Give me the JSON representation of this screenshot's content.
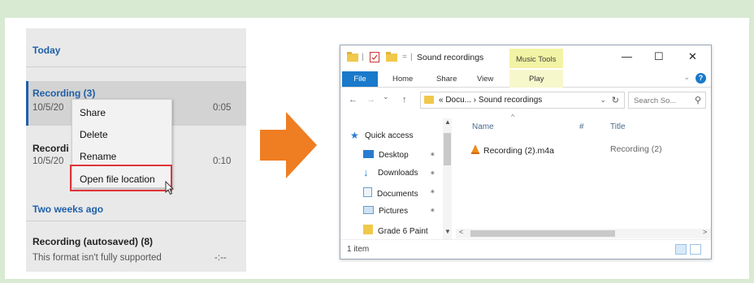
{
  "voice_recorder": {
    "section_today": "Today",
    "recording_selected": {
      "title": "Recording (3)",
      "date": "10/5/20",
      "duration": "0:05"
    },
    "recording_second": {
      "title": "Recordi",
      "date": "10/5/20",
      "duration": "0:10"
    },
    "section_two_weeks": "Two weeks ago",
    "recording_autosaved": {
      "title": "Recording (autosaved) (8)",
      "note": "This format isn't fully supported",
      "duration": "-:--"
    },
    "context_menu": {
      "items": [
        "Share",
        "Delete",
        "Rename",
        "Open file location"
      ]
    }
  },
  "explorer": {
    "title": "Sound recordings",
    "title_separator": "|",
    "qat_caret": "=",
    "context_tab_group": "Music Tools",
    "window_controls": {
      "minimize": "—",
      "maximize": "☐",
      "close": "✕"
    },
    "ribbon": {
      "tabs": [
        "File",
        "Home",
        "Share",
        "View"
      ],
      "context_tab": "Play"
    },
    "nav_buttons": {
      "back": "←",
      "forward": "→",
      "recent": "⌄",
      "up": "↑"
    },
    "address": "« Docu... › Sound recordings",
    "search_placeholder": "Search So...",
    "nav_pane": [
      {
        "label": "Quick access",
        "icon": "star-icon"
      },
      {
        "label": "Desktop",
        "icon": "desktop-icon"
      },
      {
        "label": "Downloads",
        "icon": "download-icon"
      },
      {
        "label": "Documents",
        "icon": "documents-icon"
      },
      {
        "label": "Pictures",
        "icon": "pictures-icon"
      },
      {
        "label": "Grade 6 Paint",
        "icon": "folder-icon"
      }
    ],
    "columns": [
      "Name",
      "#",
      "Title"
    ],
    "files": [
      {
        "name": "Recording (2).m4a",
        "title": "Recording (2)"
      }
    ],
    "status": "1 item"
  },
  "colors": {
    "background": "#d8ead2",
    "accent_blue": "#1f5fa8",
    "highlight_red": "#e0343a",
    "arrow_orange": "#ef7d22",
    "context_yellow": "#f3f3a5"
  }
}
